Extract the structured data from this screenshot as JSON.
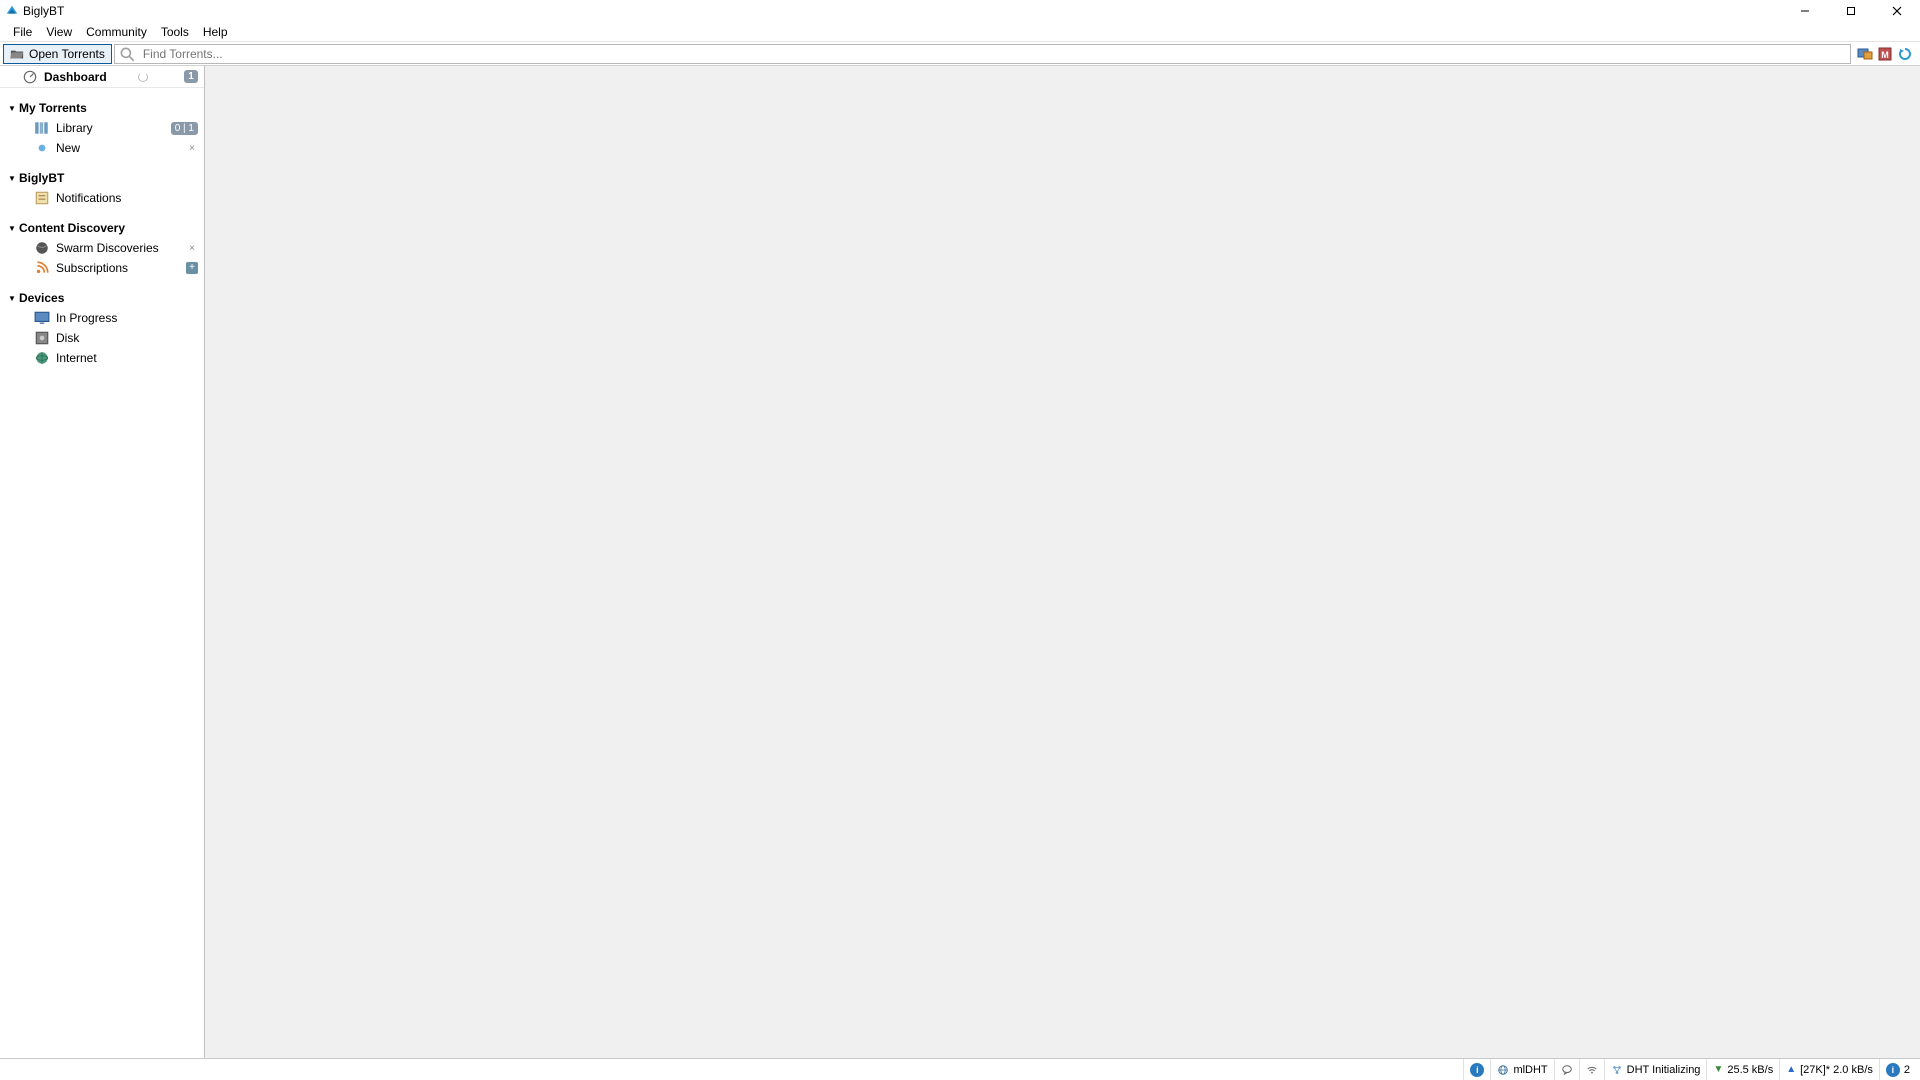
{
  "title": "BiglyBT",
  "menu": [
    "File",
    "View",
    "Community",
    "Tools",
    "Help"
  ],
  "toolbar": {
    "open_label": "Open Torrents",
    "search_placeholder": "Find Torrents..."
  },
  "sidebar": {
    "dashboard": {
      "label": "Dashboard",
      "badge": "1"
    },
    "sections": [
      {
        "label": "My Torrents",
        "items": [
          {
            "label": "Library",
            "icon": "library",
            "badge": "0 | 1",
            "close": false
          },
          {
            "label": "New",
            "icon": "dot-blue",
            "close": true
          }
        ]
      },
      {
        "label": "BiglyBT",
        "items": [
          {
            "label": "Notifications",
            "icon": "note"
          }
        ]
      },
      {
        "label": "Content Discovery",
        "items": [
          {
            "label": "Swarm Discoveries",
            "icon": "globe-dark",
            "close": true
          },
          {
            "label": "Subscriptions",
            "icon": "rss",
            "plus": true
          }
        ]
      },
      {
        "label": "Devices",
        "items": [
          {
            "label": "In Progress",
            "icon": "monitor"
          },
          {
            "label": "Disk",
            "icon": "disk"
          },
          {
            "label": "Internet",
            "icon": "globe"
          }
        ]
      }
    ]
  },
  "status": {
    "mldht": "mlDHT",
    "dht": "DHT Initializing",
    "down": "25.5 kB/s",
    "up": "[27K]* 2.0 kB/s",
    "alerts": "2"
  }
}
